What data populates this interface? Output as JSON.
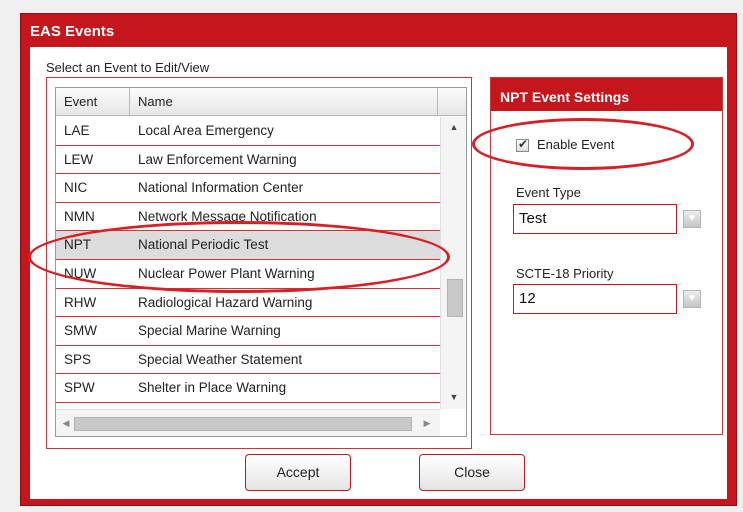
{
  "dialog": {
    "title": "EAS Events",
    "prompt": "Select an Event to Edit/View"
  },
  "event_list": {
    "columns": [
      "Event",
      "Name"
    ],
    "rows": [
      {
        "code": "LAE",
        "name": "Local Area Emergency"
      },
      {
        "code": "LEW",
        "name": "Law Enforcement Warning"
      },
      {
        "code": "NIC",
        "name": "National Information Center"
      },
      {
        "code": "NMN",
        "name": "Network Message Notification"
      },
      {
        "code": "NPT",
        "name": "National Periodic Test"
      },
      {
        "code": "NUW",
        "name": "Nuclear Power Plant Warning"
      },
      {
        "code": "RHW",
        "name": "Radiological Hazard Warning"
      },
      {
        "code": "SMW",
        "name": "Special Marine Warning"
      },
      {
        "code": "SPS",
        "name": "Special Weather Statement"
      },
      {
        "code": "SPW",
        "name": "Shelter in Place Warning"
      }
    ],
    "selected_code": "NPT"
  },
  "settings": {
    "header": "NPT Event Settings",
    "enable_label": "Enable Event",
    "enable_checked": true,
    "event_type_label": "Event Type",
    "event_type_value": "Test",
    "priority_label": "SCTE-18 Priority",
    "priority_value": "12"
  },
  "buttons": {
    "accept": "Accept",
    "close": "Close"
  },
  "colors": {
    "brand_red": "#c4161c",
    "annotation_red": "#d81f26",
    "selected_row": "#dcdcdc"
  }
}
